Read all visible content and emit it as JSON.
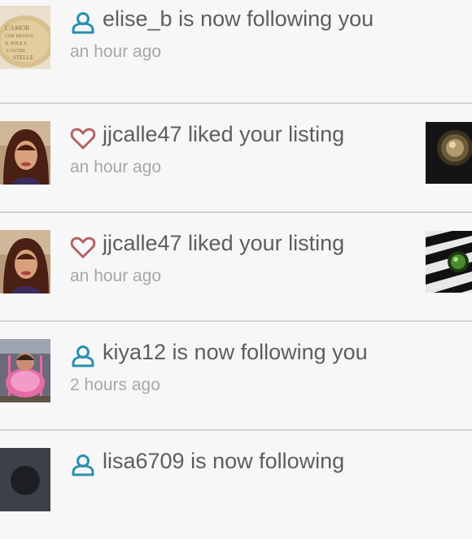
{
  "notifications": [
    {
      "type": "follow",
      "icon": "person-icon",
      "text": "elise_b is now following you",
      "time": "an hour ago"
    },
    {
      "type": "like",
      "icon": "heart-icon",
      "text": "jjcalle47 liked your listing",
      "time": "an hour ago"
    },
    {
      "type": "like",
      "icon": "heart-icon",
      "text": "jjcalle47 liked your listing",
      "time": "an hour ago"
    },
    {
      "type": "follow",
      "icon": "person-icon",
      "text": "kiya12 is now following you",
      "time": "2 hours ago"
    },
    {
      "type": "follow",
      "icon": "person-icon",
      "text": "lisa6709 is now following"
    }
  ],
  "avatar_1_text": "L'AMOR CHE MUOVE IL SOLE E L'ALTRE STELLE",
  "colors": {
    "follow_icon": "#2a8fb0",
    "like_icon": "#b46263",
    "title_text": "#5d5d62",
    "time_text": "#a7a7ab",
    "divider": "#d4d4d6",
    "background": "#f7f7f8"
  }
}
